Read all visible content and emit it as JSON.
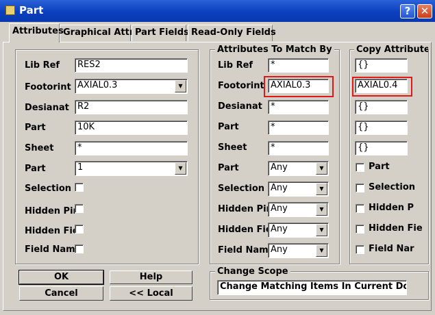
{
  "window": {
    "title": "Part",
    "help_glyph": "?",
    "close_glyph": "✕"
  },
  "tabs": [
    "Attributes",
    "Graphical Attrs",
    "Part Fields",
    "Read-Only Fields"
  ],
  "attributes": {
    "lib_ref": {
      "label": "Lib Ref",
      "value": "RES2"
    },
    "footprint": {
      "label": "Footorint",
      "value": "AXIAL0.3"
    },
    "designator": {
      "label": "Desianat",
      "value": "R2"
    },
    "part_value": {
      "label": "Part",
      "value": "10K"
    },
    "sheet": {
      "label": "Sheet",
      "value": "*"
    },
    "part_num": {
      "label": "Part",
      "value": "1"
    },
    "selection": {
      "label": "Selection"
    },
    "hidden_pins": {
      "label": "Hidden Pin"
    },
    "hidden_fields": {
      "label": "Hidden Fiel"
    },
    "field_names": {
      "label": "Field Name"
    }
  },
  "match": {
    "title": "Attributes To Match By",
    "lib_ref": {
      "label": "Lib Ref",
      "value": "*"
    },
    "footprint": {
      "label": "Footorint",
      "value": "AXIAL0.3"
    },
    "designator": {
      "label": "Desianat",
      "value": "*"
    },
    "part_value": {
      "label": "Part",
      "value": "*"
    },
    "sheet": {
      "label": "Sheet",
      "value": "*"
    },
    "part_num": {
      "label": "Part",
      "value": "Any"
    },
    "selection": {
      "label": "Selection",
      "value": "Any"
    },
    "hidden_pins": {
      "label": "Hidden Pin",
      "value": "Any"
    },
    "hidden_fields": {
      "label": "Hidden Fiel",
      "value": "Any"
    },
    "field_names": {
      "label": "Field Name",
      "value": "Any"
    }
  },
  "copy": {
    "title": "Copy Attribute",
    "lib_ref": "{}",
    "footprint": "AXIAL0.4",
    "designator": "{}",
    "part_value": "{}",
    "sheet": "{}",
    "part_label": "Part",
    "selection_label": "Selection",
    "hidden_pins_label": "Hidden P",
    "hidden_fields_label": "Hidden Fie",
    "field_names_label": "Field Nar"
  },
  "scope": {
    "title": "Change Scope",
    "value": "Change Matching Items In Current Document"
  },
  "buttons": {
    "ok": "OK",
    "help": "Help",
    "cancel": "Cancel",
    "local": "<< Local"
  },
  "colors": {
    "highlight": "#e01818",
    "face": "#d4d0c8",
    "titlebar": "#0b3fbf"
  }
}
